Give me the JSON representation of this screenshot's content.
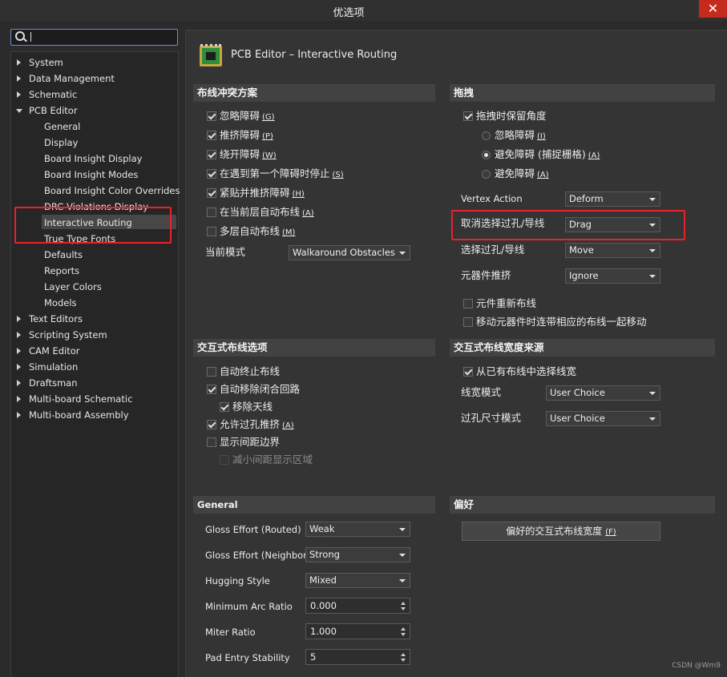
{
  "window": {
    "title": "优选项",
    "close_glyph": "✕"
  },
  "search": {
    "value": "",
    "placeholder": ""
  },
  "tree": [
    {
      "label": "System",
      "level": 0,
      "state": "collapsed"
    },
    {
      "label": "Data Management",
      "level": 0,
      "state": "collapsed"
    },
    {
      "label": "Schematic",
      "level": 0,
      "state": "collapsed"
    },
    {
      "label": "PCB Editor",
      "level": 0,
      "state": "expanded"
    },
    {
      "label": "General",
      "level": 1
    },
    {
      "label": "Display",
      "level": 1
    },
    {
      "label": "Board Insight Display",
      "level": 1
    },
    {
      "label": "Board Insight Modes",
      "level": 1
    },
    {
      "label": "Board Insight Color Overrides",
      "level": 1
    },
    {
      "label": "DRC Violations Display",
      "level": 1
    },
    {
      "label": "Interactive Routing",
      "level": 1,
      "selected": true
    },
    {
      "label": "True Type Fonts",
      "level": 1
    },
    {
      "label": "Defaults",
      "level": 1
    },
    {
      "label": "Reports",
      "level": 1
    },
    {
      "label": "Layer Colors",
      "level": 1
    },
    {
      "label": "Models",
      "level": 1
    },
    {
      "label": "Text Editors",
      "level": 0,
      "state": "collapsed"
    },
    {
      "label": "Scripting System",
      "level": 0,
      "state": "collapsed"
    },
    {
      "label": "CAM Editor",
      "level": 0,
      "state": "collapsed"
    },
    {
      "label": "Simulation",
      "level": 0,
      "state": "collapsed"
    },
    {
      "label": "Draftsman",
      "level": 0,
      "state": "collapsed"
    },
    {
      "label": "Multi-board Schematic",
      "level": 0,
      "state": "collapsed"
    },
    {
      "label": "Multi-board Assembly",
      "level": 0,
      "state": "collapsed"
    }
  ],
  "page": {
    "title": "PCB Editor – Interactive Routing"
  },
  "conflict": {
    "header": "布线冲突方案",
    "items": [
      {
        "label": "忽略障碍",
        "shortcut": "(G)",
        "checked": true
      },
      {
        "label": "推挤障碍",
        "shortcut": "(P)",
        "checked": true
      },
      {
        "label": "绕开障碍",
        "shortcut": "(W)",
        "checked": true
      },
      {
        "label": "在遇到第一个障碍时停止",
        "shortcut": "(S)",
        "checked": true
      },
      {
        "label": "紧贴并推挤障碍",
        "shortcut": "(H)",
        "checked": true
      },
      {
        "label": "在当前层自动布线",
        "shortcut": "(A)",
        "checked": false
      },
      {
        "label": "多层自动布线",
        "shortcut": "(M)",
        "checked": false
      }
    ],
    "mode_label": "当前模式",
    "mode_value": "Walkaround Obstacles"
  },
  "drag": {
    "header": "拖拽",
    "keep_angle": {
      "label": "拖拽时保留角度",
      "checked": true
    },
    "radios": [
      {
        "label": "忽略障碍",
        "shortcut": "(I)",
        "selected": false
      },
      {
        "label": "避免障碍 (捕捉栅格)",
        "shortcut": "(A)",
        "selected": true
      },
      {
        "label": "避免障碍",
        "shortcut": "(A)",
        "selected": false
      }
    ],
    "vertex_action": {
      "label": "Vertex Action",
      "value": "Deform"
    },
    "unselect_via": {
      "label": "取消选择过孔/导线",
      "value": "Drag"
    },
    "select_via": {
      "label": "选择过孔/导线",
      "value": "Move"
    },
    "comp_push": {
      "label": "元器件推挤",
      "value": "Ignore"
    },
    "reroute": {
      "label": "元件重新布线",
      "checked": false
    },
    "move_with": {
      "label": "移动元器件时连带相应的布线一起移动",
      "checked": false
    }
  },
  "options": {
    "header": "交互式布线选项",
    "items": [
      {
        "label": "自动终止布线",
        "checked": false,
        "shortcut": ""
      },
      {
        "label": "自动移除闭合回路",
        "checked": true,
        "shortcut": ""
      },
      {
        "label": "移除天线",
        "checked": true,
        "shortcut": ""
      },
      {
        "label": "允许过孔推挤",
        "checked": true,
        "shortcut": "(A)"
      },
      {
        "label": "显示间距边界",
        "checked": false,
        "shortcut": ""
      },
      {
        "label": "减小间距显示区域",
        "checked": false,
        "shortcut": ""
      }
    ]
  },
  "width_source": {
    "header": "交互式布线宽度来源",
    "pick": {
      "label": "从已有布线中选择线宽",
      "checked": true
    },
    "width_mode": {
      "label": "线宽模式",
      "value": "User Choice"
    },
    "via_size": {
      "label": "过孔尺寸模式",
      "value": "User Choice"
    }
  },
  "general": {
    "header": "General",
    "rows": [
      {
        "label": "Gloss Effort (Routed)",
        "value": "Weak",
        "kind": "dropdown"
      },
      {
        "label": "Gloss Effort (Neighbor)",
        "value": "Strong",
        "kind": "dropdown"
      },
      {
        "label": "Hugging Style",
        "value": "Mixed",
        "kind": "dropdown"
      },
      {
        "label": "Minimum Arc Ratio",
        "value": "0.000",
        "kind": "spin"
      },
      {
        "label": "Miter Ratio",
        "value": "1.000",
        "kind": "spin"
      },
      {
        "label": "Pad Entry Stability",
        "value": "5",
        "kind": "spin"
      }
    ]
  },
  "favorites": {
    "header": "偏好",
    "button": "偏好的交互式布线宽度",
    "button_shortcut": "(F)"
  },
  "watermark": "CSDN @Wm9",
  "colors": {
    "highlight": "#e8222b",
    "selection": "#474747"
  }
}
